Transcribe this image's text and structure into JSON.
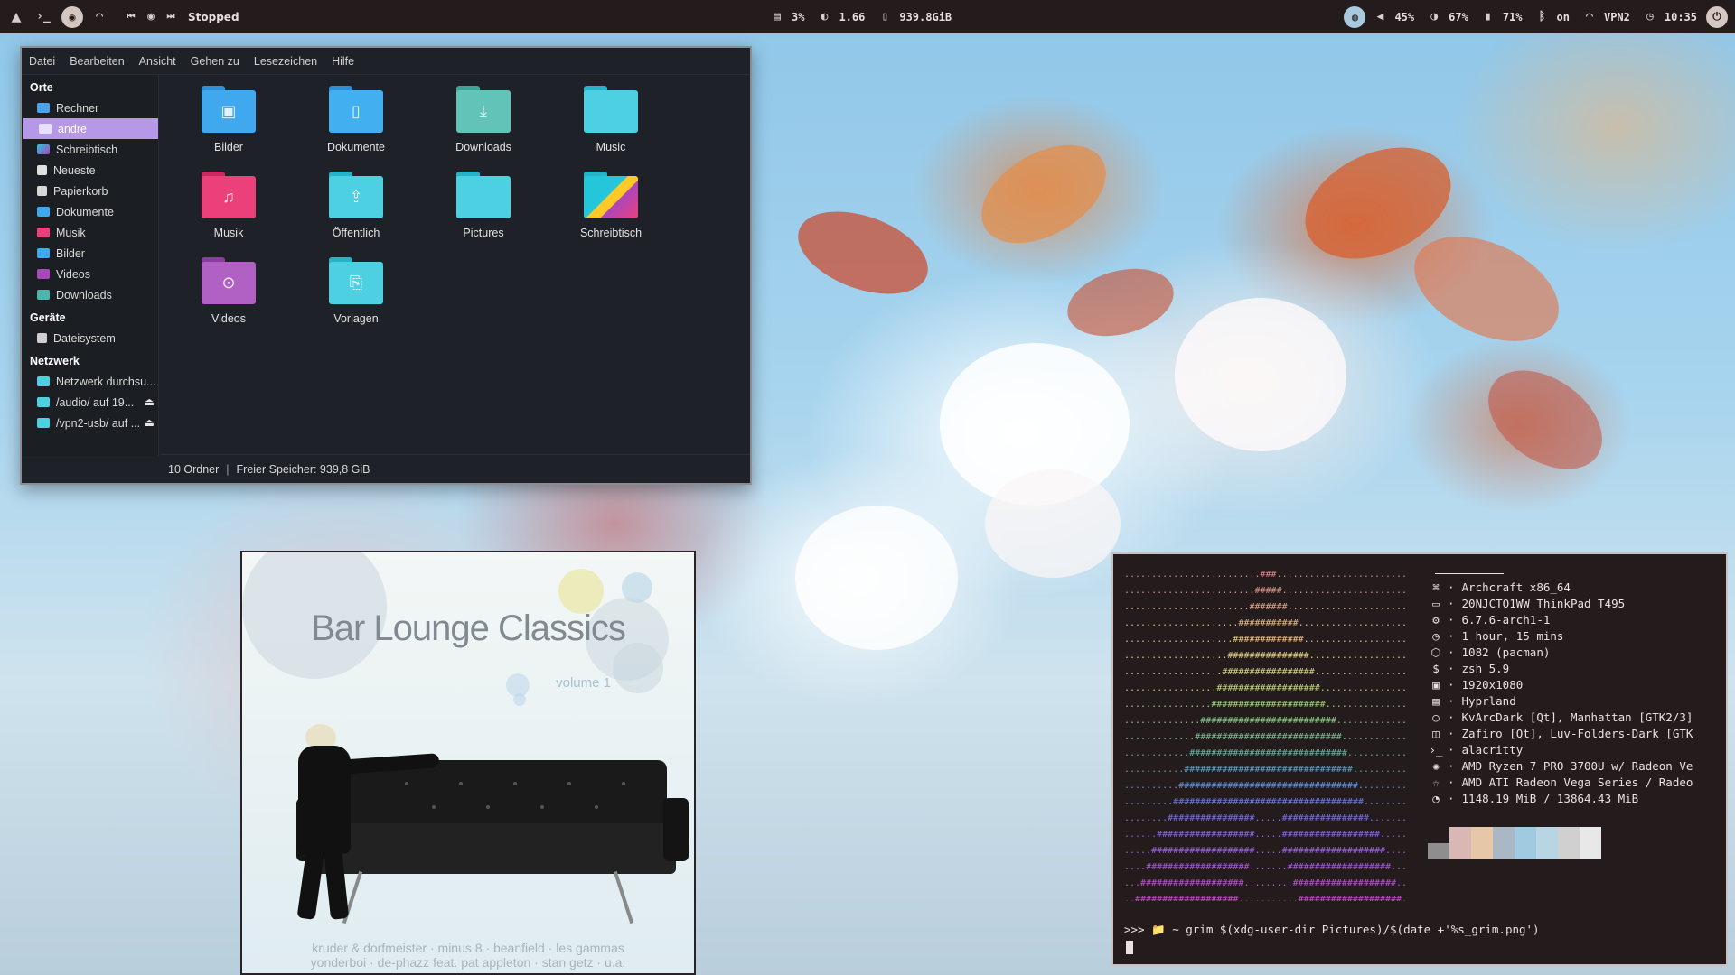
{
  "topbar": {
    "media_status": "Stopped",
    "cpu": "3%",
    "load": "1.66",
    "disk": "939.8GiB",
    "volume": "45%",
    "brightness": "67%",
    "battery": "71%",
    "bluetooth": "on",
    "vpn": "VPN2",
    "clock": "10:35"
  },
  "filemanager": {
    "menu": [
      "Datei",
      "Bearbeiten",
      "Ansicht",
      "Gehen zu",
      "Lesezeichen",
      "Hilfe"
    ],
    "sections": {
      "places": "Orte",
      "devices": "Geräte",
      "network": "Netzwerk"
    },
    "places": [
      "Rechner",
      "andre",
      "Schreibtisch",
      "Neueste",
      "Papierkorb",
      "Dokumente",
      "Musik",
      "Bilder",
      "Videos",
      "Downloads"
    ],
    "devices": [
      "Dateisystem"
    ],
    "network": [
      "Netzwerk durchsu...",
      "/audio/ auf 19...",
      "/vpn2-usb/ auf ..."
    ],
    "folders": [
      "Bilder",
      "Dokumente",
      "Downloads",
      "Music",
      "Musik",
      "Öffentlich",
      "Pictures",
      "Schreibtisch",
      "Videos",
      "Vorlagen"
    ],
    "status_count": "10 Ordner",
    "status_free": "Freier Speicher: 939,8 GiB",
    "colors": {
      "accent": "#b599e8",
      "folder_blue": "#3fa8ee",
      "folder_cyan": "#4dd0e1",
      "folder_pink": "#ec407a",
      "folder_purple": "#ab47bc"
    }
  },
  "album": {
    "title": "Bar Lounge Classics",
    "subtitle": "volume 1",
    "credits_line1": "kruder & dorfmeister · minus 8 · beanfield · les gammas",
    "credits_line2": "yonderboi · de-phazz feat. pat appleton · stan getz · u.a."
  },
  "terminal": {
    "info": [
      {
        "icon": "⌘",
        "text": "Archcraft x86_64"
      },
      {
        "icon": "▭",
        "text": "20NJCTO1WW ThinkPad T495"
      },
      {
        "icon": "⚙",
        "text": "6.7.6-arch1-1"
      },
      {
        "icon": "◷",
        "text": "1 hour, 15 mins"
      },
      {
        "icon": "⬡",
        "text": "1082 (pacman)"
      },
      {
        "icon": "$",
        "text": "zsh 5.9"
      },
      {
        "icon": "▣",
        "text": "1920x1080"
      },
      {
        "icon": "▤",
        "text": "Hyprland"
      },
      {
        "icon": "○",
        "text": "KvArcDark [Qt], Manhattan [GTK2/3]"
      },
      {
        "icon": "◫",
        "text": "Zafiro [Qt], Luv-Folders-Dark [GTK"
      },
      {
        "icon": "›_",
        "text": "alacritty"
      },
      {
        "icon": "✺",
        "text": "AMD Ryzen 7 PRO 3700U w/ Radeon Ve"
      },
      {
        "icon": "☆",
        "text": "AMD ATI Radeon Vega Series / Radeo"
      },
      {
        "icon": "◔",
        "text": "1148.19 MiB / 13864.43 MiB"
      }
    ],
    "palette": [
      "#8e8e8e",
      "#d9b7b4",
      "#e6c7a8",
      "#aab8c6",
      "#9fcae0",
      "#b8d5e4",
      "#d0d0d0",
      "#e8e8e8"
    ],
    "prompt": ">>> 📁 ~ grim $(xdg-user-dir Pictures)/$(date +'%s_grim.png')"
  }
}
